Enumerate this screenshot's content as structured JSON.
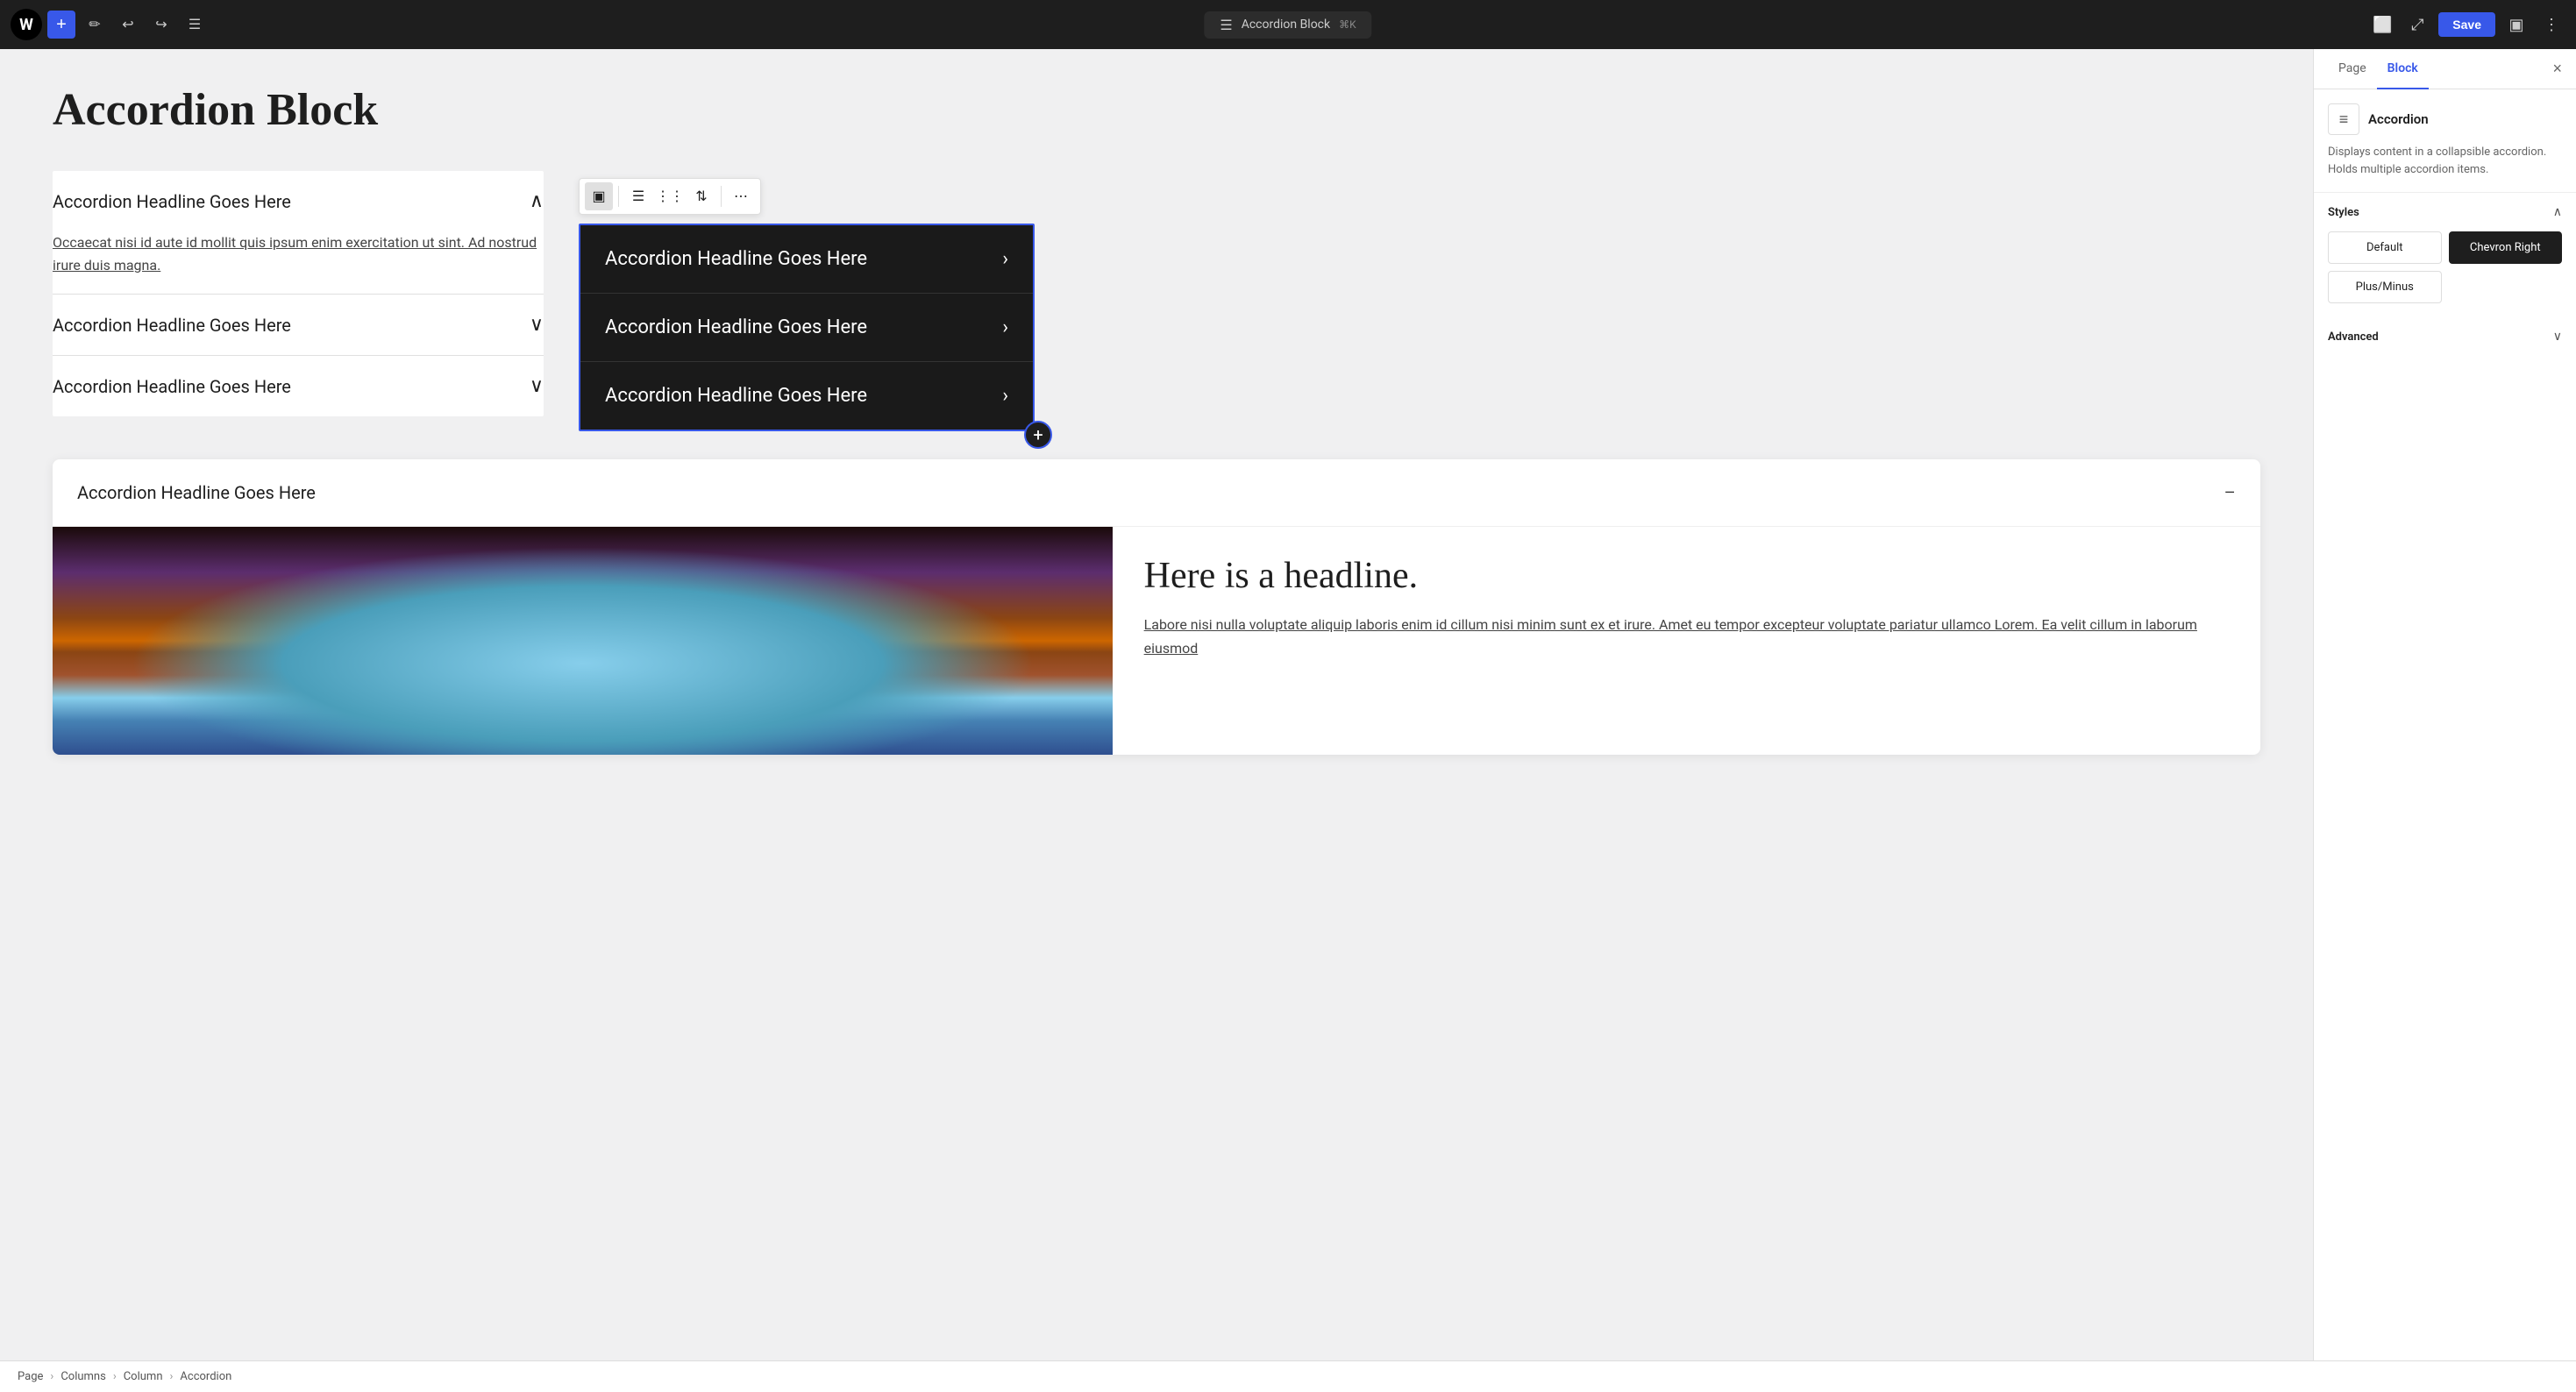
{
  "topbar": {
    "wp_logo": "W",
    "add_label": "+",
    "tools_label": "✏",
    "undo_label": "↩",
    "redo_label": "↪",
    "list_view_label": "☰",
    "center_doc_icon": "☰",
    "center_title": "Accordion Block",
    "center_shortcut": "⌘K",
    "view_icon": "⬜",
    "external_icon": "⤢",
    "save_label": "Save",
    "sidebar_icon": "▣",
    "more_icon": "⋮"
  },
  "canvas": {
    "page_title": "Accordion Block",
    "accordion_left": {
      "items": [
        {
          "headline": "Accordion Headline Goes Here",
          "open": true,
          "body": "Occaecat nisi id aute id mollit quis ipsum enim exercitation ut sint. Ad nostrud irure duis magna."
        },
        {
          "headline": "Accordion Headline Goes Here",
          "open": false
        },
        {
          "headline": "Accordion Headline Goes Here",
          "open": false
        }
      ]
    },
    "accordion_dark": {
      "items": [
        {
          "headline": "Accordion Headline Goes Here"
        },
        {
          "headline": "Accordion Headline Goes Here"
        },
        {
          "headline": "Accordion Headline Goes Here"
        }
      ]
    },
    "accordion_plusminus": {
      "header": "Accordion Headline Goes Here",
      "headline": "Here is a headline.",
      "body": "Labore nisi nulla voluptate aliquip laboris enim id cillum nisi minim sunt ex et irure. Amet eu tempor excepteur voluptate pariatur ullamco Lorem. Ea velit cillum in laborum eiusmod"
    }
  },
  "breadcrumb": {
    "page": "Page",
    "columns": "Columns",
    "column": "Column",
    "accordion": "Accordion"
  },
  "right_panel": {
    "tab_page": "Page",
    "tab_block": "Block",
    "block_icon": "≡",
    "block_name": "Accordion",
    "block_desc": "Displays content in a collapsible accordion. Holds multiple accordion items.",
    "styles_label": "Styles",
    "style_options": [
      {
        "label": "Default",
        "active": false
      },
      {
        "label": "Chevron Right",
        "active": true
      },
      {
        "label": "Plus/Minus",
        "active": false
      }
    ],
    "advanced_label": "Advanced"
  }
}
